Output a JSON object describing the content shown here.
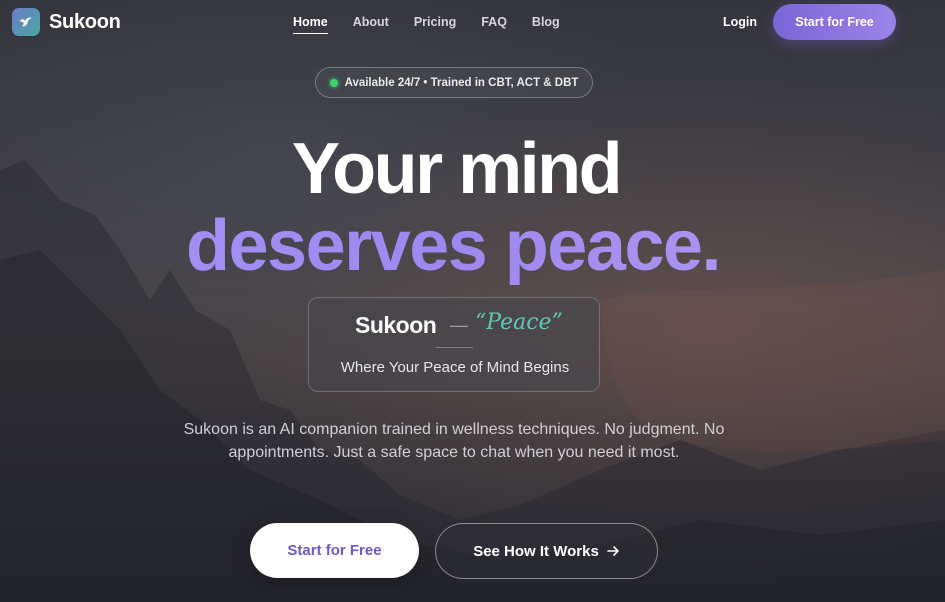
{
  "brand": {
    "name": "Sukoon",
    "logo_icon": "bird-icon"
  },
  "nav": {
    "items": [
      {
        "label": "Home",
        "active": true
      },
      {
        "label": "About",
        "active": false
      },
      {
        "label": "Pricing",
        "active": false
      },
      {
        "label": "FAQ",
        "active": false
      },
      {
        "label": "Blog",
        "active": false
      }
    ],
    "login_label": "Login",
    "cta_label": "Start for Free"
  },
  "badge": {
    "text": "Available 24/7 • Trained in CBT, ACT & DBT",
    "dot_color": "#3fd06a"
  },
  "hero": {
    "line1": "Your mind",
    "line2": "deserves peace."
  },
  "card": {
    "brand": "Sukoon",
    "dash": "—",
    "meaning": "“Peace”",
    "tagline": "Where Your Peace of Mind Begins"
  },
  "description": "Sukoon is an AI companion trained in wellness techniques. No judgment. No appointments. Just a safe space to chat when you need it most.",
  "buttons": {
    "primary": "Start for Free",
    "secondary": "See How It Works",
    "secondary_icon": "arrow-right-icon"
  },
  "colors": {
    "accent": "#9d88ef",
    "teal": "#5fc8b5",
    "cta_text": "#6a5acd"
  }
}
